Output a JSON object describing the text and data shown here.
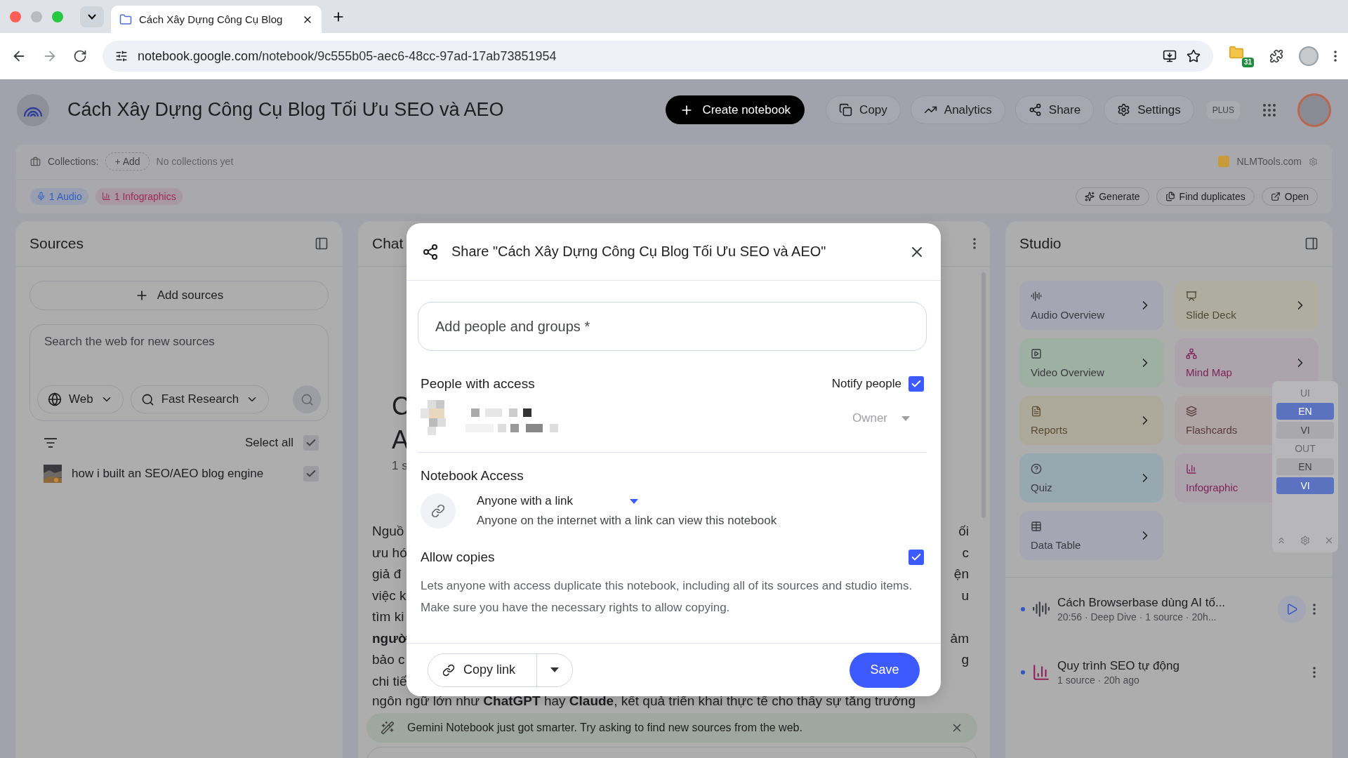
{
  "browser": {
    "tab_title": "Cách Xây Dựng Công Cụ Blog",
    "url_host": "notebook.google.com",
    "url_path": "/notebook/9c555b05-aec6-48cc-97ad-17ab73851954",
    "extension_badge": "31"
  },
  "header": {
    "title": "Cách Xây Dựng Công Cụ Blog Tối Ưu SEO và AEO",
    "create_label": "Create notebook",
    "actions": [
      {
        "label": "Copy",
        "kind": "copy"
      },
      {
        "label": "Analytics",
        "kind": "analytics"
      },
      {
        "label": "Share",
        "kind": "share"
      },
      {
        "label": "Settings",
        "kind": "settings"
      }
    ],
    "plan_badge": "PLUS"
  },
  "collections": {
    "label": "Collections:",
    "add_label": "+ Add",
    "empty_text": "No collections yet",
    "brand": "NLMTools.com",
    "chips": [
      {
        "label": "1 Audio",
        "kind": "audio",
        "color": "#2f5fc4"
      },
      {
        "label": "1 Infographics",
        "kind": "infographic",
        "color": "#a02a5a"
      }
    ],
    "tools": [
      {
        "label": "Generate",
        "kind": "generate"
      },
      {
        "label": "Find duplicates",
        "kind": "duplicates"
      },
      {
        "label": "Open",
        "kind": "open"
      }
    ]
  },
  "sources": {
    "title": "Sources",
    "add_label": "Add sources",
    "search_placeholder": "Search the web for new sources",
    "web_label": "Web",
    "research_label": "Fast Research",
    "select_all_label": "Select all",
    "select_all_checked": true,
    "items": [
      {
        "title": "how i built an SEO/AEO blog engine",
        "checked": true
      }
    ]
  },
  "chat": {
    "title": "Chat",
    "heading_fragments": [
      "C",
      "A"
    ],
    "meta_fragment": "1 s",
    "lines": [
      {
        "left": "Nguồ",
        "right": "ối",
        "bold": false
      },
      {
        "left": "ưu hó",
        "right": "c",
        "bold": false
      },
      {
        "left": "giả đ",
        "right": "ện",
        "bold": false
      },
      {
        "left": "việc k",
        "right": "u",
        "bold": false
      },
      {
        "left": "tìm ki",
        "bold": false
      },
      {
        "left": "ngườ",
        "right": "ảm",
        "bold": true
      },
      {
        "left": "bảo c",
        "right": "g",
        "bold": false
      },
      {
        "left": "chi tiế",
        "bold": false
      }
    ],
    "cut_line": "ngôn ngữ lớn như **ChatGPT** hay **Claude**, kết quả triển khai thực tế cho thấy sự tăng trưởng",
    "notice": "Gemini Notebook just got smarter. Try asking to find new sources from the web."
  },
  "studio": {
    "title": "Studio",
    "tiles": [
      {
        "label": "Audio Overview",
        "kind": "audio",
        "color": "#a5a5b3"
      },
      {
        "label": "Slide Deck",
        "kind": "slides",
        "color": "#afad9f"
      },
      {
        "label": "Video Overview",
        "kind": "video",
        "color": "#9db0a2"
      },
      {
        "label": "Mind Map",
        "kind": "mindmap",
        "color": "#ada3ad"
      },
      {
        "label": "Reports",
        "kind": "reports",
        "color": "#aca99b"
      },
      {
        "label": "Flashcards",
        "kind": "flashcards",
        "color": "#aea4a5"
      },
      {
        "label": "Quiz",
        "kind": "quiz",
        "color": "#98a8b1"
      },
      {
        "label": "Infographic",
        "kind": "infographic",
        "color": "#ada3ad"
      },
      {
        "label": "Data Table",
        "kind": "table",
        "color": "#a5a5b3"
      }
    ],
    "items": [
      {
        "title": "Cách Browserbase dùng AI tố...",
        "meta": "20:56 · Deep Dive · 1 source · 20h...",
        "kind": "audio",
        "playable": true
      },
      {
        "title": "Quy trình SEO tự động",
        "meta": "1 source · 20h ago",
        "kind": "infographic",
        "playable": false
      }
    ]
  },
  "language_widget": {
    "groups": [
      {
        "label": "UI",
        "options": [
          {
            "label": "EN",
            "selected": true
          },
          {
            "label": "VI",
            "selected": false
          }
        ]
      },
      {
        "label": "OUT",
        "options": [
          {
            "label": "EN",
            "selected": false
          },
          {
            "label": "VI",
            "selected": true
          }
        ]
      }
    ]
  },
  "dialog": {
    "title": "Share \"Cách Xây Dựng Công Cụ Blog Tối Ưu SEO và AEO\"",
    "people_placeholder": "Add people and groups *",
    "people_heading": "People with access",
    "notify_label": "Notify people",
    "notify_checked": true,
    "owner_role": "Owner",
    "access_heading": "Notebook Access",
    "access_option": "Anyone with a link",
    "access_description": "Anyone on the internet with a link can view this notebook",
    "copies_heading": "Allow copies",
    "copies_checked": true,
    "copies_description": "Lets anyone with access duplicate this notebook, including all of its sources and studio items. Make sure you have the necessary rights to allow copying.",
    "copy_link_label": "Copy link",
    "save_label": "Save"
  }
}
